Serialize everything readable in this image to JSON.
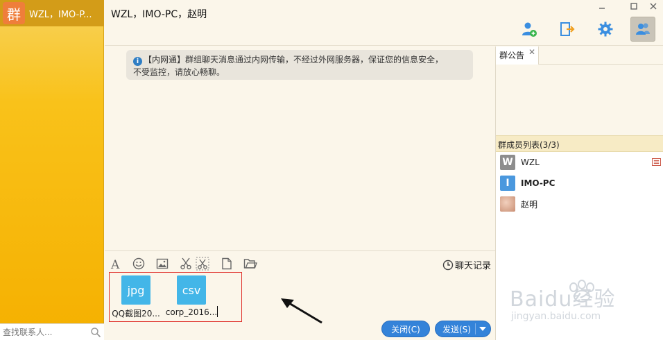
{
  "rail": {
    "group_badge": "群",
    "conversation_title": "WZL，IMO-P...",
    "search_placeholder": "查找联系人..."
  },
  "header": {
    "title": "WZL，IMO-PC，赵明",
    "buttons": [
      "add-member-icon",
      "exit-group-icon",
      "settings-icon",
      "members-icon"
    ]
  },
  "messages": {
    "notice_line1": "【内网通】群组聊天消息通过内网传输，不经过外网服务器，保证您的信息安全，",
    "notice_line2": "不受监控，请放心畅聊。"
  },
  "toolbar": {
    "history_label": "聊天记录"
  },
  "attachments": [
    {
      "type": "jpg",
      "name": "QQ截图20..."
    },
    {
      "type": "csv",
      "name": "corp_2016..."
    }
  ],
  "actions": {
    "close_label": "关闭(C)",
    "send_label": "发送(S)"
  },
  "right_panel": {
    "notice_tab": "群公告",
    "members_header": "群成员列表(3/3)",
    "members": [
      {
        "name": "WZL",
        "initial": "W",
        "color": "#8d8d8d"
      },
      {
        "name": "IMO-PC",
        "initial": "I",
        "color": "#4a98de"
      },
      {
        "name": "赵明",
        "initial": "",
        "color": "#d9a58c"
      }
    ]
  },
  "watermark": {
    "line1": "Baidu经验",
    "line2": "jingyan.baidu.com"
  },
  "colors": {
    "accent": "#3483d9",
    "rail": "#f9c21a",
    "attach_border": "#e0322c",
    "file_tile": "#43b6e8"
  }
}
